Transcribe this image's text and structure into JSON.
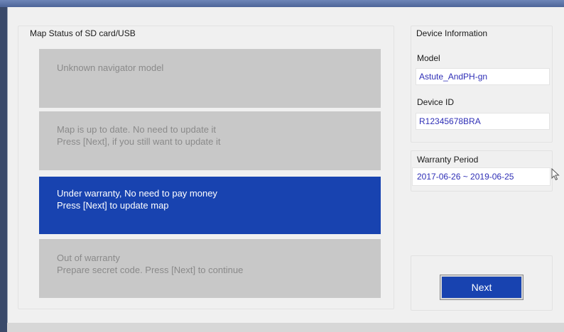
{
  "map_status": {
    "title": "Map Status of SD card/USB",
    "items": [
      {
        "lines": [
          "Unknown navigator model"
        ],
        "selected": false
      },
      {
        "lines": [
          "Map is up to date. No need to update it",
          "Press [Next], if you still want to update it"
        ],
        "selected": false
      },
      {
        "lines": [
          "Under warranty, No need to pay money",
          "Press [Next] to update map"
        ],
        "selected": true
      },
      {
        "lines": [
          "Out of warranty",
          "Prepare secret code. Press [Next] to continue"
        ],
        "selected": false
      }
    ]
  },
  "device_info": {
    "title": "Device Information",
    "model_label": "Model",
    "model_value": "Astute_AndPH-gn",
    "device_id_label": "Device ID",
    "device_id_value": "R12345678BRA"
  },
  "warranty": {
    "title": "Warranty Period",
    "value": "2017-06-26 ~ 2019-06-25"
  },
  "next_button": {
    "label": "Next"
  },
  "colors": {
    "selected_bg": "#1843b0",
    "unselected_bg": "#c8c8c8",
    "value_text": "#2e2eb6"
  }
}
